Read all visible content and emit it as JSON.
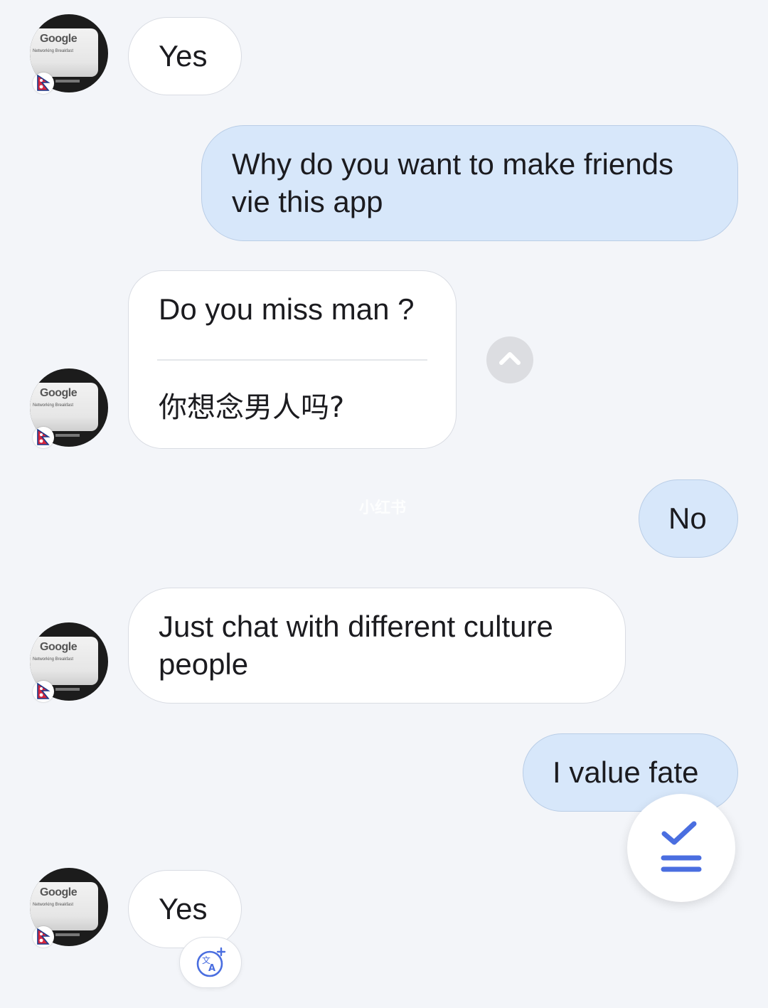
{
  "colors": {
    "background": "#f3f5f9",
    "incoming_bubble": "#ffffff",
    "outgoing_bubble": "#d7e7fa",
    "accent": "#4a6ee0"
  },
  "contact": {
    "avatar_screen_text": "Google",
    "avatar_screen_subtext": "Networking Breakfast",
    "flag_icon": "nepal-flag-icon"
  },
  "messages": [
    {
      "direction": "incoming",
      "text": "Yes"
    },
    {
      "direction": "outgoing",
      "text": "Why do you want to make friends\nvie this app"
    },
    {
      "direction": "incoming",
      "text": "Do you miss man ?",
      "translation": "你想念男人吗?"
    },
    {
      "direction": "outgoing",
      "text": "No"
    },
    {
      "direction": "incoming",
      "text": "Just chat with different culture\npeople"
    },
    {
      "direction": "outgoing",
      "text": "I value fate"
    },
    {
      "direction": "incoming",
      "text": "Yes"
    }
  ],
  "controls": {
    "collapse_icon": "chevron-up-icon",
    "fab_icon": "check-list-icon",
    "translate_icon": "translate-icon"
  },
  "watermark": "小红书"
}
